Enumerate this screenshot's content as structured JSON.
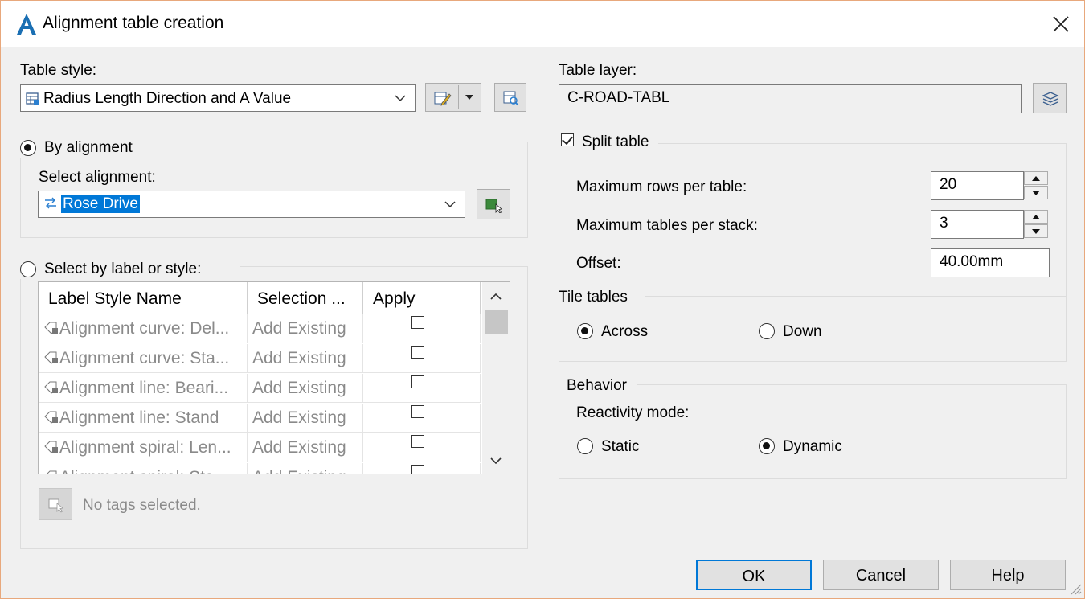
{
  "window": {
    "title": "Alignment table creation"
  },
  "left": {
    "table_style_label": "Table style:",
    "table_style_value": "Radius Length Direction and A Value",
    "by_alignment_label": "By alignment",
    "select_alignment_label": "Select alignment:",
    "alignment_value": "Rose Drive",
    "select_by_label_label": "Select by label or style:",
    "grid": {
      "columns": [
        "Label Style Name",
        "Selection ...",
        "Apply"
      ],
      "rows": [
        {
          "name": "Alignment curve: Del...",
          "selection": "Add Existing",
          "apply": false
        },
        {
          "name": "Alignment curve: Sta...",
          "selection": "Add Existing",
          "apply": false
        },
        {
          "name": "Alignment line: Beari...",
          "selection": "Add Existing",
          "apply": false
        },
        {
          "name": "Alignment line: Stand",
          "selection": "Add Existing",
          "apply": false
        },
        {
          "name": "Alignment spiral: Len...",
          "selection": "Add Existing",
          "apply": false
        },
        {
          "name": "Alignment spiral: Sta...",
          "selection": "Add Existing",
          "apply": false
        }
      ]
    },
    "no_tags_text": "No tags selected."
  },
  "right": {
    "table_layer_label": "Table layer:",
    "table_layer_value": "C-ROAD-TABL",
    "split_table_label": "Split table",
    "split_table_checked": true,
    "max_rows_label": "Maximum rows per table:",
    "max_rows_value": "20",
    "max_tables_label": "Maximum tables per stack:",
    "max_tables_value": "3",
    "offset_label": "Offset:",
    "offset_value": "40.00mm",
    "tile_tables_label": "Tile tables",
    "across_label": "Across",
    "down_label": "Down",
    "tile_selected": "Across",
    "behavior_label": "Behavior",
    "reactivity_label": "Reactivity mode:",
    "static_label": "Static",
    "dynamic_label": "Dynamic",
    "reactivity_selected": "Dynamic"
  },
  "buttons": {
    "ok": "OK",
    "cancel": "Cancel",
    "help": "Help"
  },
  "colors": {
    "accent": "#0078d7",
    "highlight": "#0078d7",
    "app_icon": "#1a6fb3"
  }
}
